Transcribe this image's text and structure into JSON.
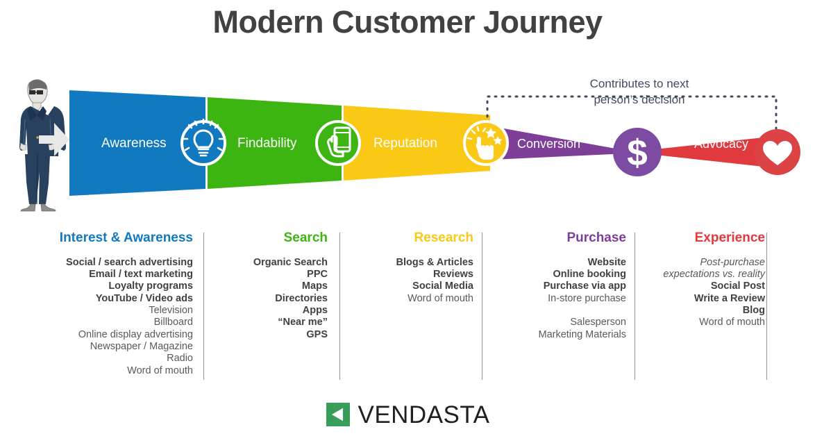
{
  "title": "Modern Customer Journey",
  "annotation": {
    "line1": "Contributes to next",
    "line2": "person’s decision"
  },
  "colors": {
    "awareness": "#1079bf",
    "findability": "#3cb512",
    "reputation": "#f9c916",
    "conversion": "#7e3f98",
    "advocacy": "#e0393e",
    "dollar": "#7e4ba3",
    "heart": "#dc4344",
    "title": "#414042",
    "note": "#3f4a61",
    "body": "#58595b",
    "body_bold": "#414042",
    "divider": "#8b9099",
    "intro_arrow": "#e8e8e8",
    "logo_green": "#3a9e5b",
    "logo_text": "#231f20"
  },
  "funnel": {
    "stages": [
      {
        "label": "Awareness",
        "icon": "lightbulb-icon",
        "color_key": "awareness"
      },
      {
        "label": "Findability",
        "icon": "hand-phone-icon",
        "color_key": "findability"
      },
      {
        "label": "Reputation",
        "icon": "tap-stars-icon",
        "color_key": "reputation"
      },
      {
        "label": "Conversion",
        "icon": "dollar-icon",
        "color_key": "conversion"
      },
      {
        "label": "Advocacy",
        "icon": "heart-icon",
        "color_key": "advocacy"
      }
    ]
  },
  "columns": [
    {
      "heading": "Interest & Awareness",
      "color": "#1079bf",
      "items": [
        {
          "text": "Social / search advertising",
          "style": "bold"
        },
        {
          "text": "Email / text marketing",
          "style": "bold"
        },
        {
          "text": "Loyalty programs",
          "style": "bold"
        },
        {
          "text": "YouTube / Video ads",
          "style": "bold"
        },
        {
          "text": "Television",
          "style": "regular"
        },
        {
          "text": "Billboard",
          "style": "regular"
        },
        {
          "text": "Online display advertising",
          "style": "regular"
        },
        {
          "text": "Newspaper / Magazine",
          "style": "regular"
        },
        {
          "text": "Radio",
          "style": "regular"
        },
        {
          "text": "Word of mouth",
          "style": "regular"
        }
      ]
    },
    {
      "heading": "Search",
      "color": "#3cb512",
      "items": [
        {
          "text": "Organic Search",
          "style": "bold"
        },
        {
          "text": "PPC",
          "style": "bold"
        },
        {
          "text": "Maps",
          "style": "bold"
        },
        {
          "text": "Directories",
          "style": "bold"
        },
        {
          "text": "Apps",
          "style": "bold"
        },
        {
          "text": "“Near me”",
          "style": "bold"
        },
        {
          "text": "GPS",
          "style": "bold"
        }
      ]
    },
    {
      "heading": "Research",
      "color": "#f9c916",
      "items": [
        {
          "text": "Blogs & Articles",
          "style": "bold"
        },
        {
          "text": "Reviews",
          "style": "bold"
        },
        {
          "text": "Social Media",
          "style": "bold"
        },
        {
          "text": "Word of mouth",
          "style": "regular"
        }
      ]
    },
    {
      "heading": "Purchase",
      "color": "#7e3f98",
      "items": [
        {
          "text": "Website",
          "style": "bold"
        },
        {
          "text": "Online booking",
          "style": "bold"
        },
        {
          "text": "Purchase via app",
          "style": "bold"
        },
        {
          "text": "In-store purchase",
          "style": "regular"
        },
        {
          "text": " ",
          "style": "spacer"
        },
        {
          "text": "Salesperson",
          "style": "regular"
        },
        {
          "text": "Marketing Materials",
          "style": "regular"
        }
      ]
    },
    {
      "heading": "Experience",
      "color": "#e0393e",
      "items": [
        {
          "text": "Post-purchase",
          "style": "italic"
        },
        {
          "text": "expectations vs. reality",
          "style": "italic"
        },
        {
          "text": "Social Post",
          "style": "bold"
        },
        {
          "text": "Write a Review",
          "style": "bold"
        },
        {
          "text": "Blog",
          "style": "bold"
        },
        {
          "text": "Word of mouth",
          "style": "regular"
        }
      ]
    }
  ],
  "logo": {
    "text": "VENDASTA",
    "mark": "vendasta-mark-icon"
  }
}
